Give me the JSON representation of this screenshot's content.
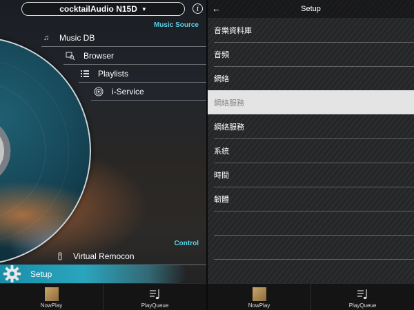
{
  "left": {
    "device_name": "cocktailAudio N15D",
    "caret": "▼",
    "info_symbol": "i",
    "section_music_source": "Music Source",
    "section_control": "Control",
    "menu": [
      {
        "label": "Music DB",
        "icon": "music-note-icon"
      },
      {
        "label": "Browser",
        "icon": "browser-search-icon"
      },
      {
        "label": "Playlists",
        "icon": "playlist-icon"
      },
      {
        "label": "i-Service",
        "icon": "radio-waves-icon"
      }
    ],
    "virtual_remocon": {
      "label": "Virtual Remocon",
      "icon": "remote-icon"
    },
    "setup": {
      "label": "Setup",
      "icon": "gear-icon"
    },
    "bottom": {
      "nowplay": "NowPlay",
      "playqueue": "PlayQueue"
    },
    "accent_color": "#5ad0e6"
  },
  "right": {
    "title": "Setup",
    "back_symbol": "←",
    "rows": [
      {
        "label": "音樂資料庫",
        "selected": false
      },
      {
        "label": "音頻",
        "selected": false
      },
      {
        "label": "網絡",
        "selected": false
      },
      {
        "label": "網絡服務",
        "selected": true
      },
      {
        "label": "網絡服務",
        "selected": false
      },
      {
        "label": "系統",
        "selected": false
      },
      {
        "label": "時間",
        "selected": false
      },
      {
        "label": "韌體",
        "selected": false
      }
    ],
    "bottom": {
      "nowplay": "NowPlay",
      "playqueue": "PlayQueue"
    }
  }
}
